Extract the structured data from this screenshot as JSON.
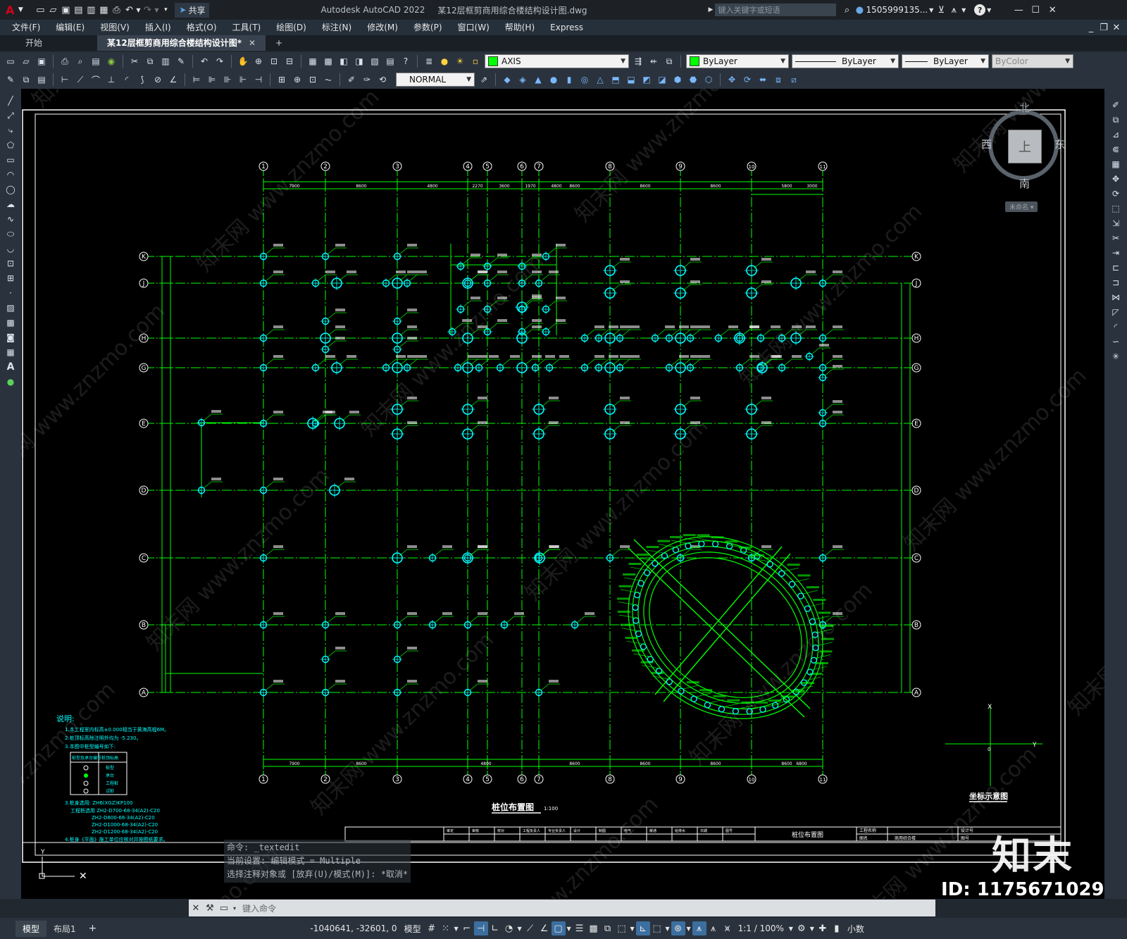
{
  "titlebar": {
    "app_logo": "A",
    "share_label": "共享",
    "app_name": "Autodesk AutoCAD 2022",
    "doc_name": "某12层框剪商用综合楼结构设计图.dwg",
    "search_placeholder": "键入关键字或短语",
    "user": "1505999135...",
    "help": "?"
  },
  "menus": [
    "文件(F)",
    "编辑(E)",
    "视图(V)",
    "插入(I)",
    "格式(O)",
    "工具(T)",
    "绘图(D)",
    "标注(N)",
    "修改(M)",
    "参数(P)",
    "窗口(W)",
    "帮助(H)",
    "Express"
  ],
  "tabs": {
    "start": "开始",
    "file": "某12层框剪商用综合楼结构设计图*",
    "close": "✕",
    "add": "+"
  },
  "toolbar": {
    "layer": "AXIS",
    "color": "ByLayer",
    "linetype": "ByLayer",
    "lineweight": "ByLayer",
    "plotstyle": "ByColor",
    "dimstyle": "NORMAL"
  },
  "colors": {
    "accent": "#00ff00",
    "cad_bg": "#000000",
    "circle": "#00ffff",
    "marker": "#00ffff",
    "dim": "#00ff00",
    "ui_bg": "#2a333d"
  },
  "viewcube": {
    "north": "北",
    "south": "南",
    "east": "东",
    "west": "西",
    "top": "上",
    "ucs": "未命名"
  },
  "drawing": {
    "axis_numbers": [
      "1",
      "2",
      "3",
      "4",
      "5",
      "6",
      "7",
      "8",
      "9",
      "10",
      "11"
    ],
    "axis_letters": [
      "K",
      "J",
      "H",
      "G",
      "E",
      "D",
      "C",
      "B",
      "A"
    ],
    "top_dims": [
      "7900",
      "8600",
      "4800",
      "2270",
      "3600",
      "1970",
      "4800",
      "8600",
      "8600",
      "8600",
      "5800",
      "3000"
    ],
    "bottom_dims": [
      "7900",
      "8600",
      "4800",
      "8600",
      "8600",
      "8600",
      "8600",
      "6800"
    ],
    "plan_title": "桩位布置图",
    "plan_scale": "1:100",
    "coord_title": "坐标示意图",
    "coord_x": "X",
    "coord_y": "Y",
    "coord_o": "0",
    "notes_title": "说明:",
    "notes": [
      "1.本工程室内标高±0.000相当于黄海高程6M。",
      "2.桩顶标高除注明外均为 -5.230。",
      "3.本图中桩型编号如下:"
    ],
    "legend_headers": [
      "桩型及承台编号",
      "桩顶标高"
    ],
    "legend_rows": [
      "桩型",
      "承台",
      "工程桩",
      "试桩"
    ],
    "pile_spec_title": "3.桩身选用: ZH6(XGZ)KP100",
    "pile_specs": [
      "工程桩选用 ZH2-D700-68-34(A2)-C20",
      "ZH2-D800-68-34(A2)-C20",
      "ZH2-D1000-68-34(A2)-C20",
      "ZH2-D1200-68-34(A2)-C20"
    ],
    "notes_4": "4.桩身《平面》施工单位应核对并按图纸要求。",
    "titleblock_name": "桩位布置图",
    "titleblock_cells": [
      "审定",
      "审核",
      "校对",
      "工程负责人",
      "专业负责人",
      "设计",
      "制图",
      "电气",
      "暖通",
      "给排水",
      "日期",
      "图号"
    ],
    "titleblock_right": [
      "工程名称",
      "图名",
      "建设单位",
      "设计号",
      "商用综合楼",
      "图号"
    ]
  },
  "watermark": {
    "text": "知末网 www.znzmo.com",
    "brand": "知末",
    "id_label": "ID: 1175671029"
  },
  "commandline": {
    "history": [
      "命令: _textedit",
      "当前设置: 编辑模式 = Multiple",
      "选择注释对象或 [放弃(U)/模式(M)]: *取消*"
    ],
    "prompt_placeholder": "键入命令"
  },
  "statusbar": {
    "model_tab": "模型",
    "layout_tab": "布局1",
    "add": "+",
    "coords": "-1040641, -32601, 0",
    "mode": "模型",
    "scale": "1:1 / 100%",
    "units": "小数"
  }
}
